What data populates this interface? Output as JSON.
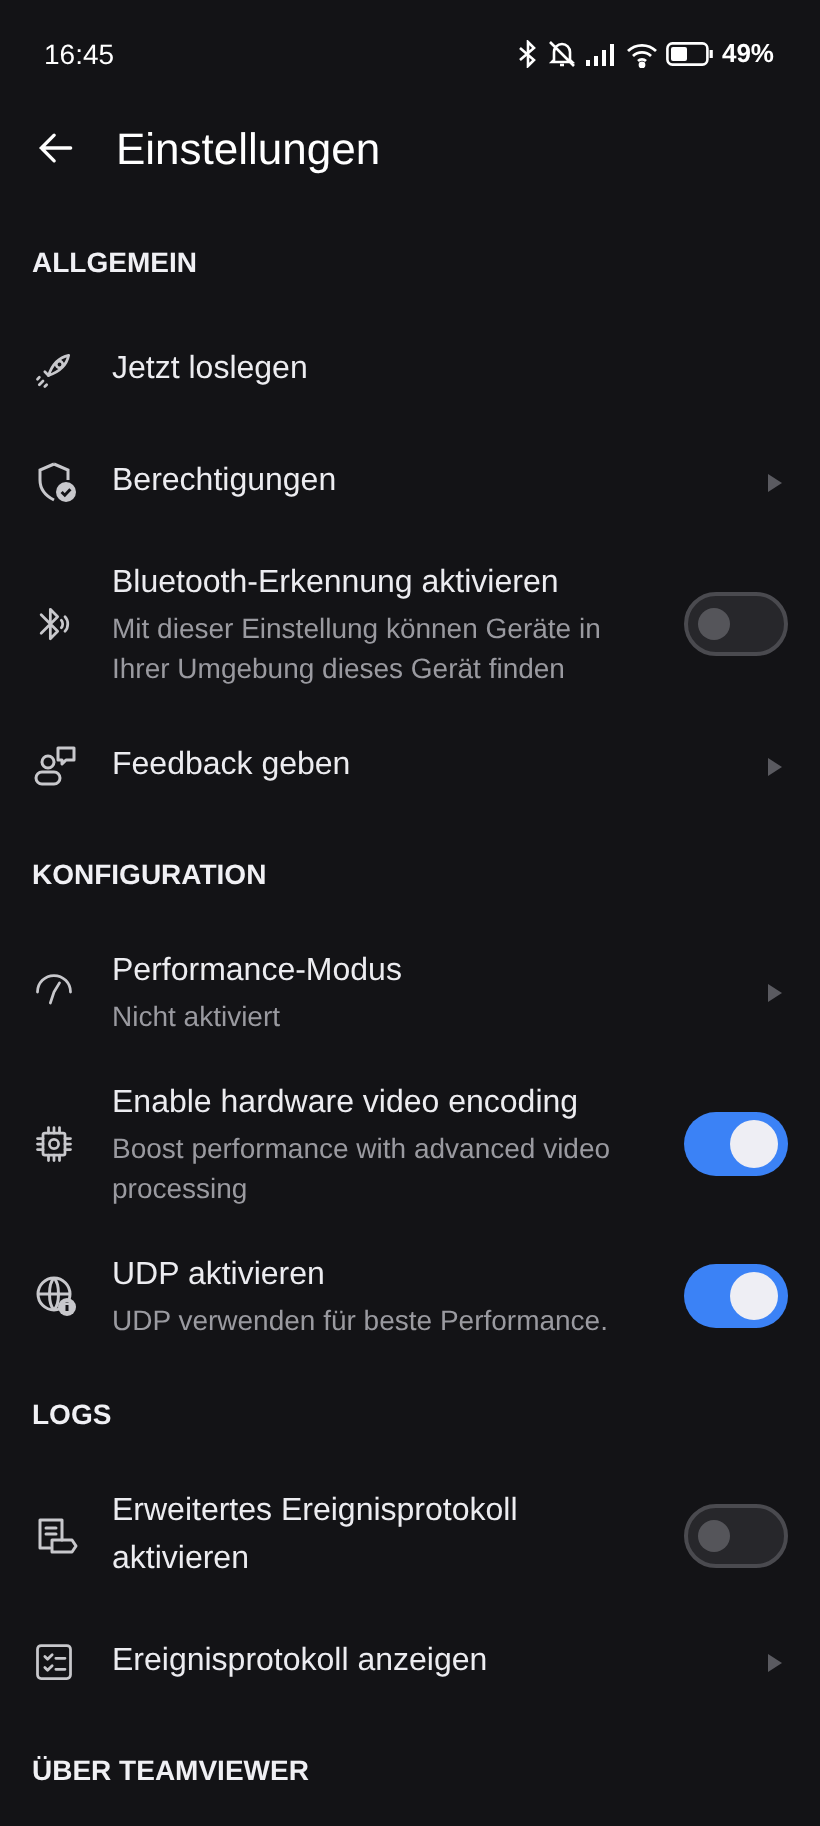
{
  "status_bar": {
    "time": "16:45",
    "battery": "49%"
  },
  "header": {
    "title": "Einstellungen"
  },
  "sections": [
    {
      "title": "ALLGEMEIN",
      "items": [
        {
          "kind": "plain",
          "title": "Jetzt loslegen"
        },
        {
          "kind": "link",
          "title": "Berechtigungen"
        },
        {
          "kind": "toggle",
          "title": "Bluetooth-Erkennung aktivieren",
          "subtitle": "Mit dieser Einstellung können Geräte in Ihrer Umgebung dieses Gerät finden",
          "on": false
        },
        {
          "kind": "link",
          "title": "Feedback geben"
        }
      ]
    },
    {
      "title": "KONFIGURATION",
      "items": [
        {
          "kind": "link",
          "title": "Performance-Modus",
          "subtitle": "Nicht aktiviert"
        },
        {
          "kind": "toggle",
          "title": "Enable hardware video encoding",
          "subtitle": "Boost performance with advanced video processing",
          "on": true
        },
        {
          "kind": "toggle",
          "title": "UDP aktivieren",
          "subtitle": "UDP verwenden für beste Performance.",
          "on": true
        }
      ]
    },
    {
      "title": "LOGS",
      "items": [
        {
          "kind": "toggle",
          "title": "Erweitertes Ereignisprotokoll aktivieren",
          "on": false
        },
        {
          "kind": "link",
          "title": "Ereignisprotokoll anzeigen"
        }
      ]
    },
    {
      "title": "ÜBER TEAMVIEWER"
    }
  ]
}
